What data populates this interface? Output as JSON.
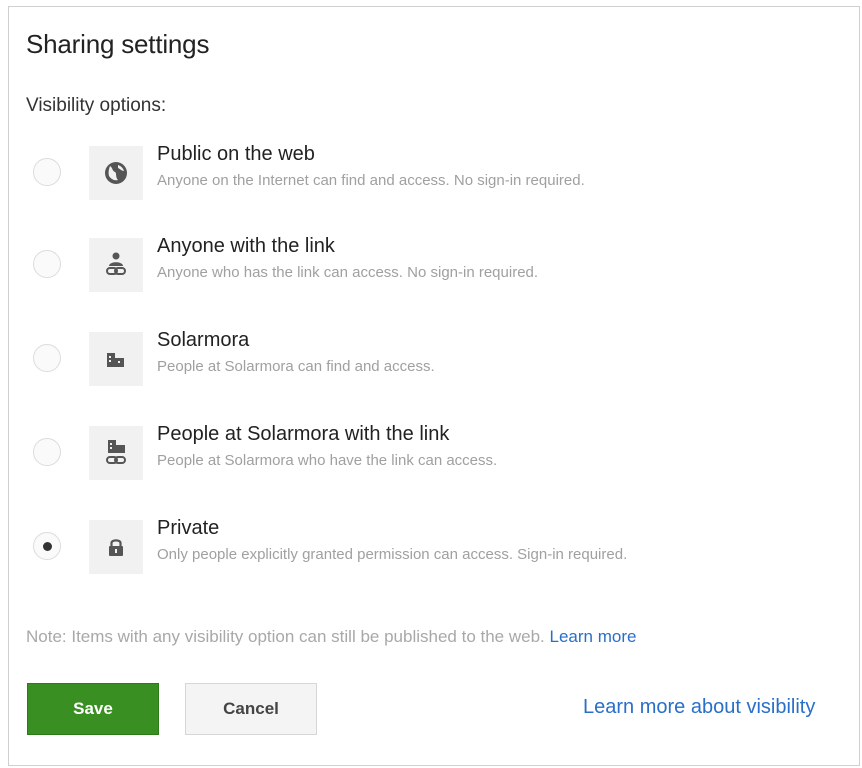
{
  "dialog": {
    "title": "Sharing settings",
    "section_label": "Visibility options:"
  },
  "options": [
    {
      "title": "Public on the web",
      "description": "Anyone on the Internet can find and access. No sign-in required.",
      "icon": "globe-icon",
      "selected": false
    },
    {
      "title": "Anyone with the link",
      "description": "Anyone who has the link can access. No sign-in required.",
      "icon": "person-link-icon",
      "selected": false
    },
    {
      "title": "Solarmora",
      "description": "People at Solarmora can find and access.",
      "icon": "building-icon",
      "selected": false
    },
    {
      "title": "People at Solarmora with the link",
      "description": "People at Solarmora who have the link can access.",
      "icon": "building-link-icon",
      "selected": false
    },
    {
      "title": "Private",
      "description": "Only people explicitly granted permission can access. Sign-in required.",
      "icon": "lock-icon",
      "selected": true
    }
  ],
  "note": {
    "text": "Note: Items with any visibility option can still be published to the web.",
    "link": "Learn more"
  },
  "buttons": {
    "save": "Save",
    "cancel": "Cancel"
  },
  "footer_link": "Learn more about visibility",
  "colors": {
    "save_green": "#3a8f23",
    "link_blue": "#2a6fc7",
    "muted_text": "#a0a0a0"
  }
}
